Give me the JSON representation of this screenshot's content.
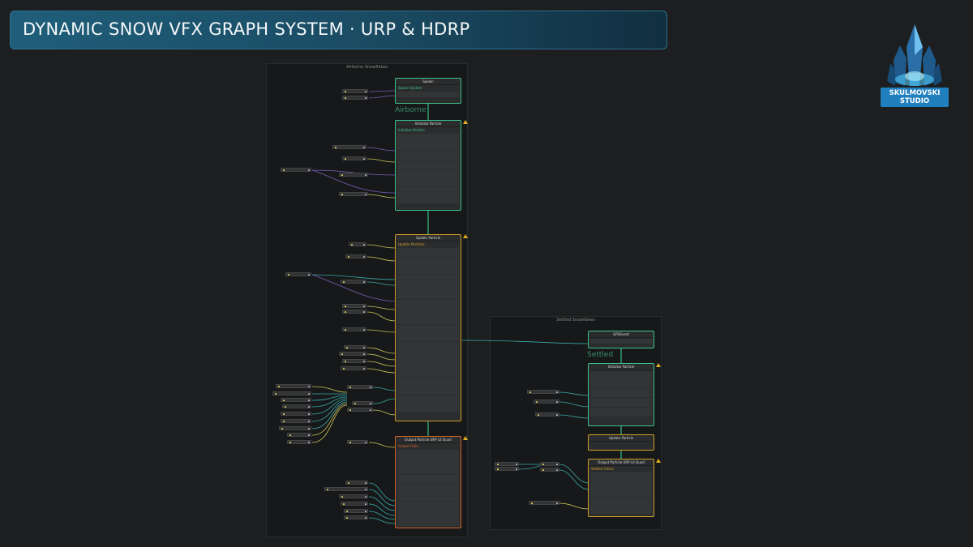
{
  "title": "DYNAMIC SNOW VFX GRAPH SYSTEM · URP & HDRP",
  "logo": {
    "line1": "SKULMOVSKI",
    "line2": "STUDIO",
    "icon": "crystal-logo-icon"
  },
  "panels": {
    "airborne": "Airborne Snowflakes",
    "settled": "Settled Snowflakes"
  },
  "context_labels": {
    "airborne": "Airborne",
    "settled": "Settled"
  },
  "nodes": {
    "spawn": {
      "head": "Spawn",
      "sub": "Spawn System"
    },
    "init_airborne": {
      "head": "Initialize Particle",
      "sub": "Initialize Particle"
    },
    "update_airborne": {
      "head": "Update Particle",
      "sub": "Update Particles"
    },
    "output_airborne": {
      "head": "Output Particle URP Lit Quad",
      "sub": "Output Fade"
    },
    "gpu_event": {
      "head": "GPUEvent"
    },
    "init_settled": {
      "head": "Initialize Particle"
    },
    "update_settled": {
      "head": "Update Particle"
    },
    "output_settled": {
      "head": "Output Particle URP Lit Quad",
      "sub": "Settled Flakes"
    }
  },
  "colors": {
    "green": "#3cc48a",
    "yellow": "#d0a02a",
    "red": "#d0642a",
    "wire_purple": "#7b5cb8",
    "wire_teal": "#3aa8a8",
    "wire_yellow": "#c9c45a"
  }
}
